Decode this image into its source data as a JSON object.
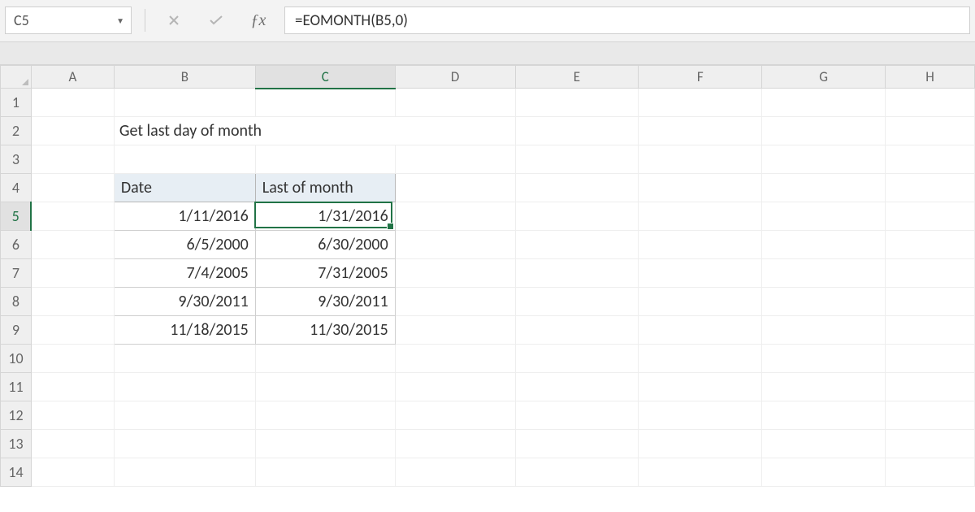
{
  "colors": {
    "accent": "#217346"
  },
  "namebox": {
    "value": "C5"
  },
  "formula": {
    "value": "=EOMONTH(B5,0)"
  },
  "columns": [
    "A",
    "B",
    "C",
    "D",
    "E",
    "F",
    "G",
    "H"
  ],
  "rows": [
    "1",
    "2",
    "3",
    "4",
    "5",
    "6",
    "7",
    "8",
    "9",
    "10",
    "11",
    "12",
    "13",
    "14"
  ],
  "active": {
    "col": "C",
    "row": "5"
  },
  "title": "Get last day of month",
  "table": {
    "headers": {
      "date": "Date",
      "last": "Last of month"
    },
    "rows": [
      {
        "date": "1/11/2016",
        "last": "1/31/2016"
      },
      {
        "date": "6/5/2000",
        "last": "6/30/2000"
      },
      {
        "date": "7/4/2005",
        "last": "7/31/2005"
      },
      {
        "date": "9/30/2011",
        "last": "9/30/2011"
      },
      {
        "date": "11/18/2015",
        "last": "11/30/2015"
      }
    ]
  }
}
